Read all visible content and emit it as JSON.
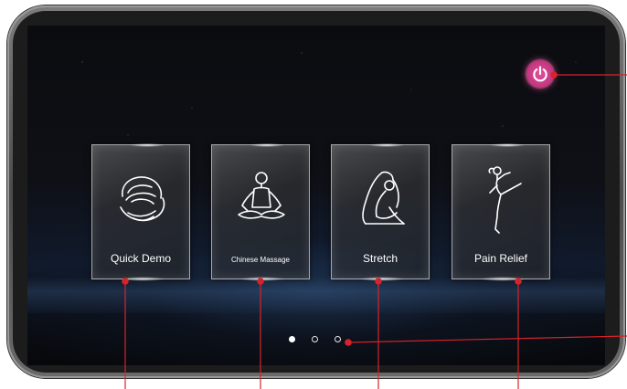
{
  "colors": {
    "power_accent": "#d4407f",
    "callout_line": "#d8232a",
    "card_text": "#ffffff"
  },
  "power_button": {
    "icon": "power-icon"
  },
  "cards": [
    {
      "label": "Quick Demo",
      "icon": "hands-icon"
    },
    {
      "label": "Chinese Massage",
      "icon": "meditation-icon"
    },
    {
      "label": "Stretch",
      "icon": "yoga-stretch-icon"
    },
    {
      "label": "Pain Relief",
      "icon": "kick-pose-icon"
    }
  ],
  "pagination": {
    "total_pages": 3,
    "current_page": 1
  }
}
